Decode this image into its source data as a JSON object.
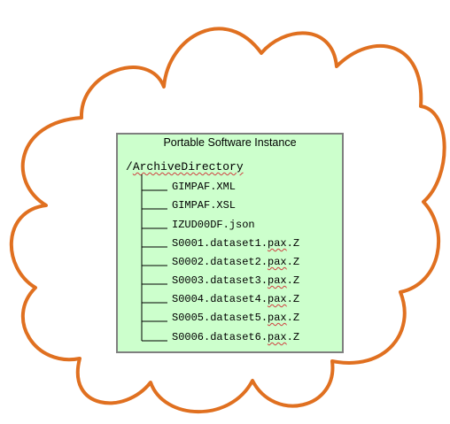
{
  "diagram": {
    "cloud_color": "#e07020",
    "box_fill": "#ccffcc",
    "box_border": "#7f7f7f",
    "title": "Portable Software Instance",
    "root": {
      "prefix": "/",
      "name": "ArchiveDirectory"
    },
    "files": [
      {
        "plain": "GIMPAF.XML",
        "squiggle": ""
      },
      {
        "plain": "GIMPAF.XSL",
        "squiggle": ""
      },
      {
        "plain": "IZUD00DF.json",
        "squiggle": ""
      },
      {
        "plain": "S0001.dataset1.",
        "squiggle": "pax",
        "suffix": ".Z"
      },
      {
        "plain": "S0002.dataset2.",
        "squiggle": "pax",
        "suffix": ".Z"
      },
      {
        "plain": "S0003.dataset3.",
        "squiggle": "pax",
        "suffix": ".Z"
      },
      {
        "plain": "S0004.dataset4.",
        "squiggle": "pax",
        "suffix": ".Z"
      },
      {
        "plain": "S0005.dataset5.",
        "squiggle": "pax",
        "suffix": ".Z"
      },
      {
        "plain": "S0006.dataset6.",
        "squiggle": "pax",
        "suffix": ".Z"
      }
    ]
  }
}
